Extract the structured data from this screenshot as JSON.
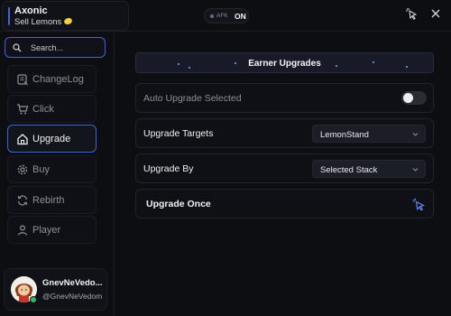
{
  "app": {
    "title": "Axonic",
    "subtitle": "Sell Lemons",
    "accent": "#3f63d8"
  },
  "afk": {
    "label": "AFK",
    "state": "ON"
  },
  "search": {
    "placeholder": "Search..."
  },
  "sidebar": {
    "items": [
      {
        "label": "ChangeLog",
        "icon": "changelog-icon",
        "active": false
      },
      {
        "label": "Click",
        "icon": "cart-icon",
        "active": false
      },
      {
        "label": "Upgrade",
        "icon": "home-icon",
        "active": true
      },
      {
        "label": "Buy",
        "icon": "gear-icon",
        "active": false
      },
      {
        "label": "Rebirth",
        "icon": "refresh-icon",
        "active": false
      },
      {
        "label": "Player",
        "icon": "user-icon",
        "active": false
      }
    ]
  },
  "profile": {
    "display_name": "GnevNeVedo...",
    "handle": "@GnevNeVedom",
    "status_color": "#2fb86a"
  },
  "main": {
    "section_title": "Earner Upgrades",
    "auto_upgrade": {
      "label": "Auto Upgrade Selected",
      "enabled": false
    },
    "upgrade_targets": {
      "label": "Upgrade Targets",
      "value": "LemonStand"
    },
    "upgrade_by": {
      "label": "Upgrade By",
      "value": "Selected Stack"
    },
    "upgrade_once": {
      "label": "Upgrade Once"
    }
  }
}
